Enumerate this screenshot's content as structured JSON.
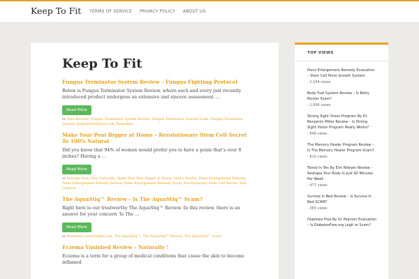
{
  "site": {
    "title": "Keep To Fit",
    "nav": [
      "TERMS OF SERVICE",
      "PRIVACY POLICY",
      "ABOUT US"
    ]
  },
  "main": {
    "title": "Keep To Fit",
    "read_more_label": "Read More",
    "posts": [
      {
        "title": "Fungus Terminator System Review – Fungus Fighting Protocol",
        "excerpt": "Below is Fungus Terminator System Review, where each and every just recently introduced product undergoes an extensive and sincere assessment …",
        "tags_prefix": "in",
        "tags": [
          "Dave Bowser",
          "Fungus Terminator System Review",
          "Fungus Terminator System Scam",
          "Fungus Terminator System",
          "fungusterminator.com",
          "Remedies"
        ]
      },
      {
        "title": "Make Your Peni Bigger at Home – Revolutionary Stem Cell Secret To 100% Natural",
        "excerpt": "Did you know that 94% of women would prefer you to have a penis that’s over 8 inches? Having a …",
        "tags_prefix": "in",
        "tags": [
          "Enlarge Penis Size Naturally",
          "Make Your Peni Bigger at Home",
          "Men's Health",
          "Penis Enlargement Remedy",
          "Penis Enlargement Remedy Review",
          "Penis Enlargement Remedy Scam",
          "Revolutionary Stem Cell Secret",
          "Tom Candow"
        ]
      },
      {
        "title": "The AquaStiq™ Review – Is The AquaStiq™ Scam?",
        "excerpt": "Right here is our trustworthy The AquaStiq™ Review. In this review, there is an answer for your concern ‘Is The …",
        "tags_prefix": "in",
        "tags": [
          "Remedies",
          "survivallife.com",
          "The AquaStiq™",
          "The AquaStiq™ Review",
          "The AquaStiq™ Scam"
        ]
      },
      {
        "title": "Eczema Vanished Review – Naturally !",
        "excerpt": "Eczema is a term for a group of medical conditions that cause the skin to become inflamed",
        "tags_prefix": "",
        "tags": []
      }
    ]
  },
  "sidebar": {
    "widget_title": "TOP VIEWS",
    "items": [
      {
        "title": "Penis Enlargement Remedy Evaluation – Stem Cell Penis Growth System",
        "views": "- 2,164 views"
      },
      {
        "title": "Body Fuel System Review – Is Betty Rocker Scam?",
        "views": "- 1,906 views"
      },
      {
        "title": "Strong Sight Vision Program By Dr. Benjamin Miller Review – Is Strong Sight Vision Program Really Works?",
        "views": "- 848 views"
      },
      {
        "title": "The Memory Healer Program Review – Is The Memory Healer Program Scam?",
        "views": "- 810 views"
      },
      {
        "title": "Toned In Ten By Erin Nielsen Review – Reshape Your Body In Just 90 Minutes Per Week",
        "views": "- 477 views"
      },
      {
        "title": "Survive In Bed Review – Is Survive In Bed SCAM?",
        "views": "- 383 views"
      },
      {
        "title": "Diabetes Free By Dr Pearson Evaluation – Is DiabetesFree.org Legit or Scam?",
        "views": ""
      }
    ]
  },
  "colors": {
    "accent": "#e8a020",
    "link": "#e6a21c",
    "button": "#5cb85c",
    "background": "#ecebe8"
  }
}
